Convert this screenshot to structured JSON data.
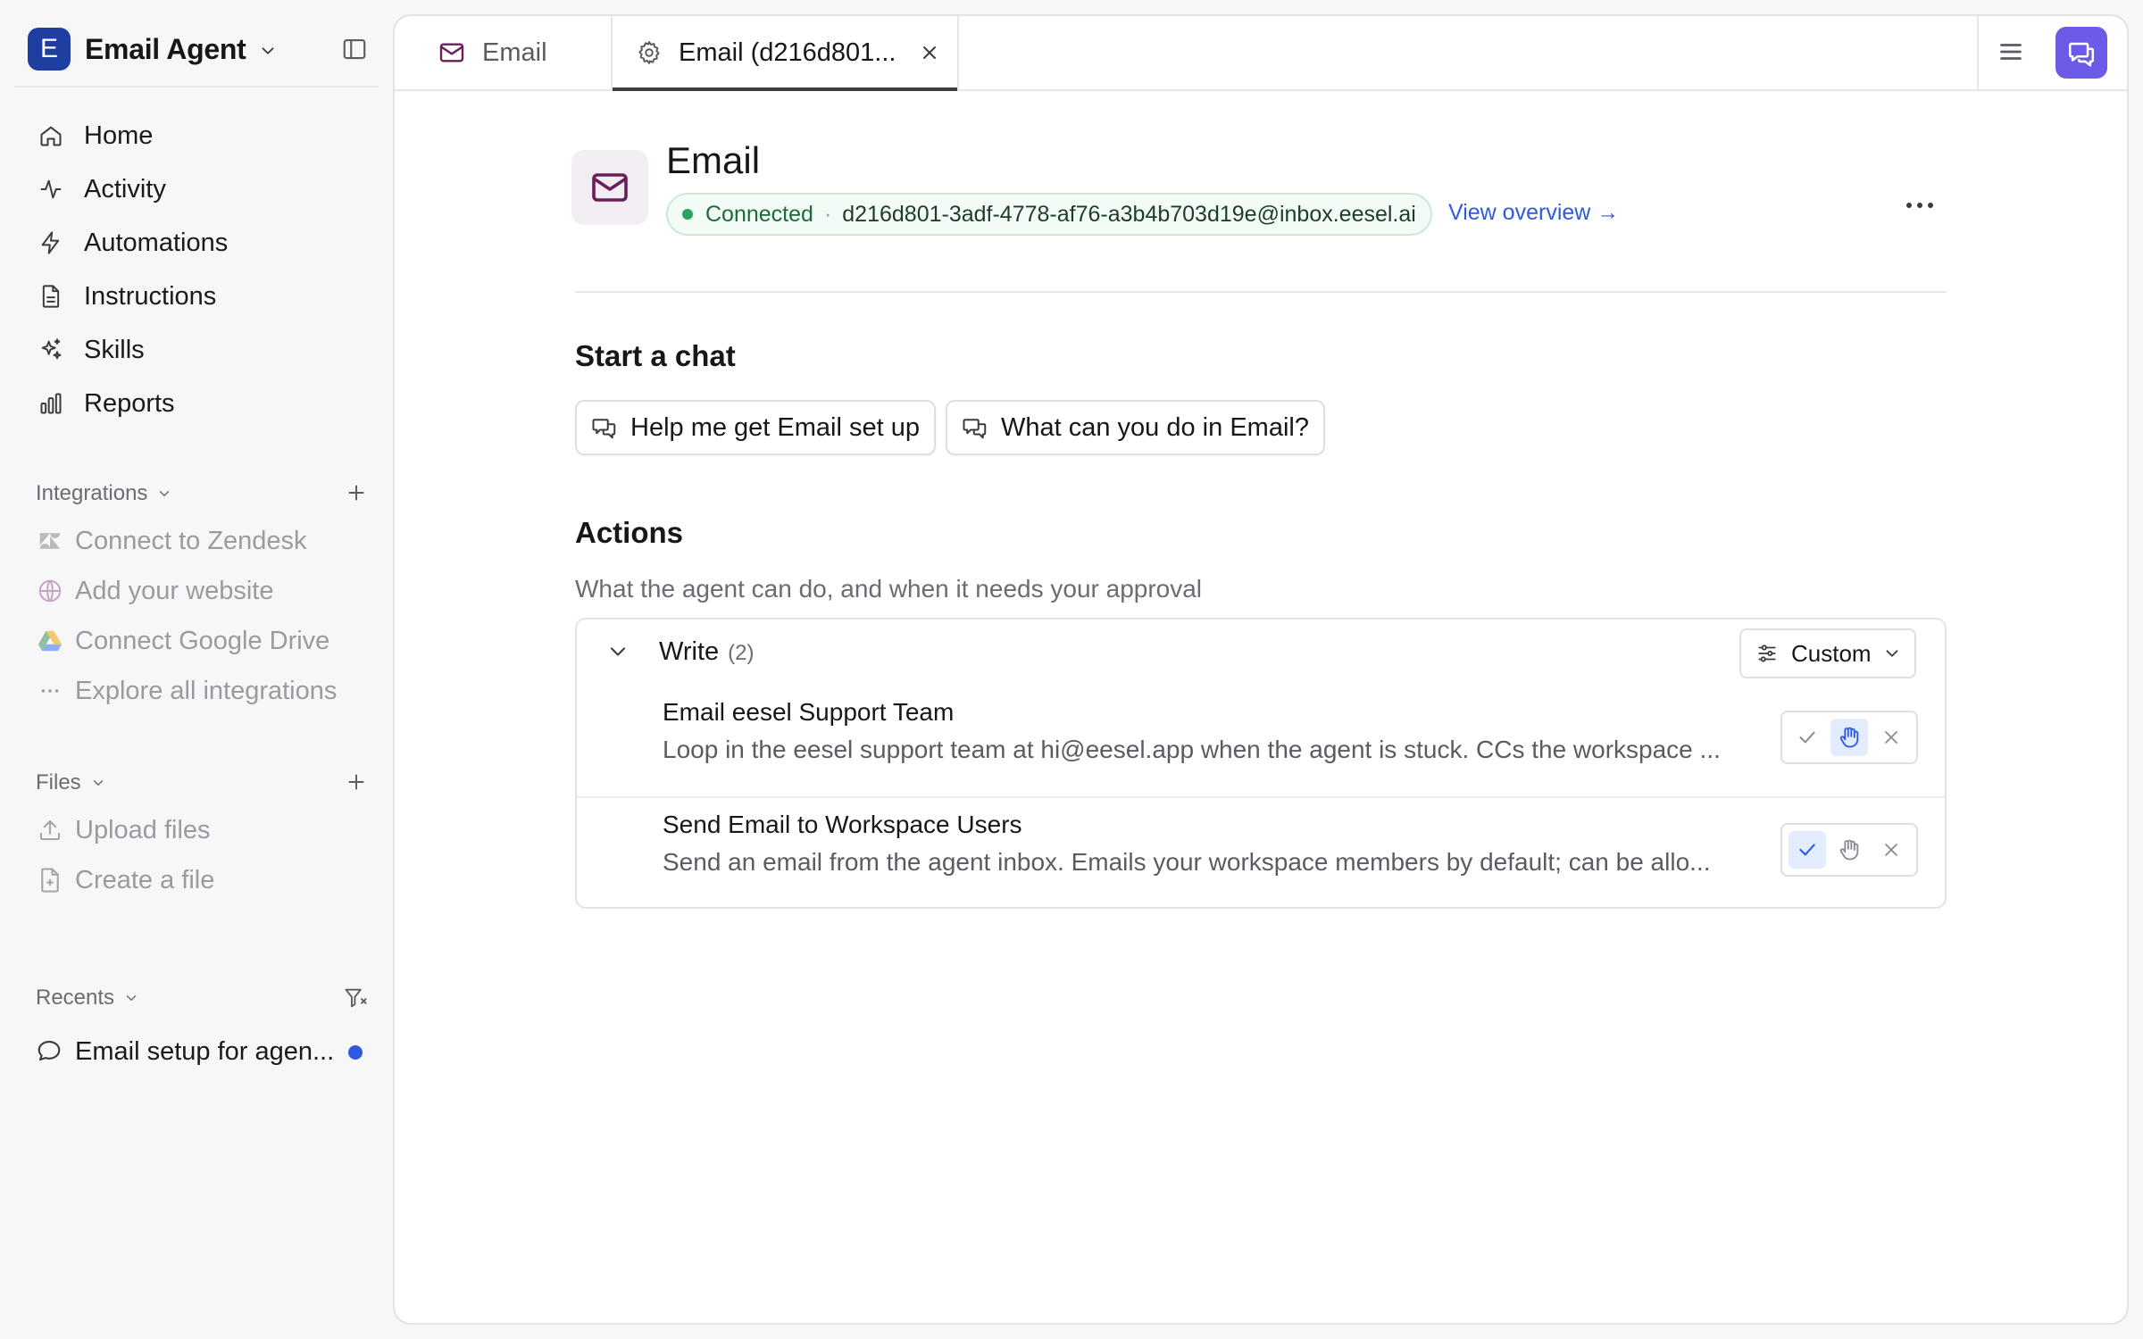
{
  "workspace": {
    "initial": "E",
    "name": "Email Agent"
  },
  "nav": [
    {
      "label": "Home",
      "icon": "home-icon"
    },
    {
      "label": "Activity",
      "icon": "activity-icon"
    },
    {
      "label": "Automations",
      "icon": "lightning-icon"
    },
    {
      "label": "Instructions",
      "icon": "document-icon"
    },
    {
      "label": "Skills",
      "icon": "sparkles-icon"
    },
    {
      "label": "Reports",
      "icon": "bar-chart-icon"
    }
  ],
  "integrations": {
    "heading": "Integrations",
    "items": [
      {
        "label": "Connect to Zendesk",
        "icon": "zendesk-icon"
      },
      {
        "label": "Add your website",
        "icon": "globe-icon"
      },
      {
        "label": "Connect Google Drive",
        "icon": "google-drive-icon"
      },
      {
        "label": "Explore all integrations",
        "icon": "ellipsis-icon"
      }
    ]
  },
  "files": {
    "heading": "Files",
    "items": [
      {
        "label": "Upload files",
        "icon": "upload-icon"
      },
      {
        "label": "Create a file",
        "icon": "file-plus-icon"
      }
    ]
  },
  "recents": {
    "heading": "Recents",
    "items": [
      {
        "label": "Email setup for agen...",
        "icon": "chat-bubble-icon",
        "unread": true
      }
    ]
  },
  "tabs": [
    {
      "label": "Email",
      "icon": "mail-icon",
      "active": false
    },
    {
      "label": "Email (d216d801...",
      "icon": "gear-icon",
      "active": true,
      "closable": true
    }
  ],
  "integration_page": {
    "title": "Email",
    "status": "Connected",
    "separator": "·",
    "address": "d216d801-3adf-4778-af76-a3b4b703d19e@inbox.eesel.ai",
    "view_overview": "View overview →"
  },
  "start_chat": {
    "heading": "Start a chat",
    "chips": [
      "Help me get Email set up",
      "What can you do in Email?"
    ]
  },
  "actions": {
    "heading": "Actions",
    "subtitle": "What the agent can do, and when it needs your approval",
    "group": {
      "title": "Write",
      "count": "(2)",
      "mode_label": "Custom"
    },
    "items": [
      {
        "title": "Email eesel Support Team",
        "description": "Loop in the eesel support team at hi@eesel.app when the agent is stuck. CCs the workspace ...",
        "permission": "ask"
      },
      {
        "title": "Send Email to Workspace Users",
        "description": "Send an email from the agent inbox. Emails your workspace members by default; can be allo...",
        "permission": "allow"
      }
    ]
  },
  "colors": {
    "accent": "#2f5ae0",
    "connected": "#27a55a",
    "chat_button": "#6b5be7",
    "mail_icon": "#6b1e5a"
  }
}
